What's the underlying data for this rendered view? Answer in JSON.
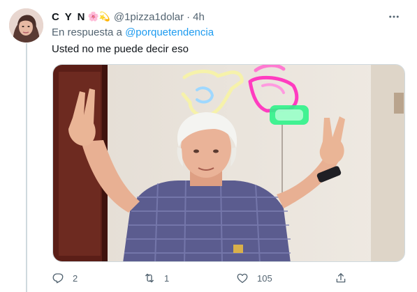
{
  "tweet": {
    "display_name": "C Y N",
    "emoji": "🌸💫",
    "handle": "@1pizza1dolar",
    "separator": "·",
    "time": "4h",
    "reply_prefix": "En respuesta a",
    "reply_mention": "@porquetendencia",
    "text": "Usted no me puede decir eso"
  },
  "actions": {
    "reply_count": "2",
    "retweet_count": "1",
    "like_count": "105"
  },
  "icons": {
    "more": "more-icon",
    "reply": "reply-icon",
    "retweet": "retweet-icon",
    "like": "heart-icon",
    "share": "share-icon"
  },
  "colors": {
    "link": "#1d9bf0",
    "secondary_text": "#536471",
    "primary_text": "#0f1419"
  }
}
